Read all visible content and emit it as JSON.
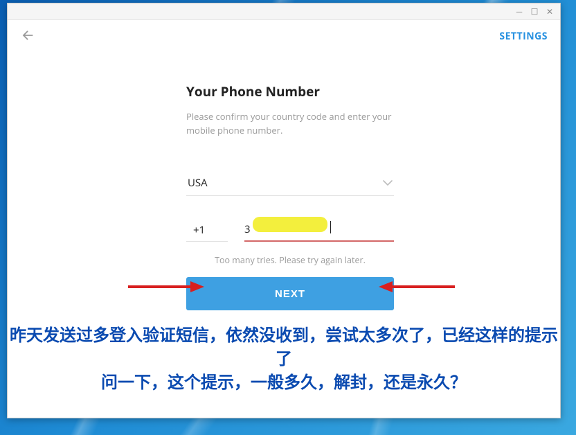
{
  "header": {
    "settings_label": "SETTINGS"
  },
  "form": {
    "title": "Your Phone Number",
    "subtitle": "Please confirm your country code and enter your mobile phone number.",
    "country": "USA",
    "country_code": "+1",
    "phone_partial": "3",
    "error": "Too many tries. Please try again later.",
    "next_label": "NEXT"
  },
  "annotation": {
    "line1": "昨天发送过多登入验证短信，依然没收到，尝试太多次了，已经这样的提示了",
    "line2": "问一下，这个提示，一般多久，解封，还是永久？"
  }
}
